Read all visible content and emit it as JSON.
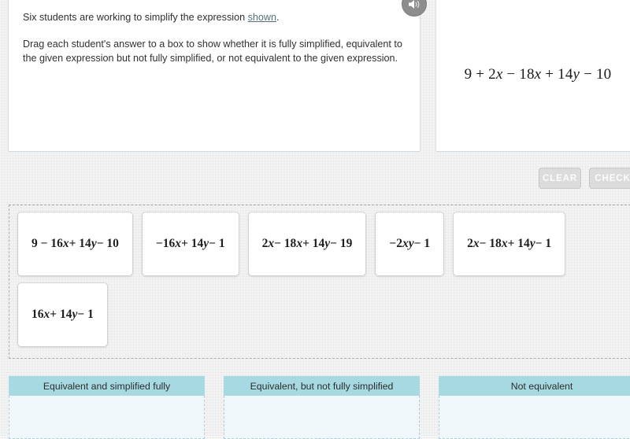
{
  "prompt": {
    "line1_before": "Six students are working to simplify the expression ",
    "line1_link": "shown",
    "line1_after": ".",
    "line2": "Drag each student's answer to a box to show whether it is fully simplified, equivalent to the given expression but not fully simplified, or not equivalent to the given expression."
  },
  "expression": {
    "display": "9 + 2x − 18x + 14y − 10",
    "parts": [
      {
        "t": "9 + 2",
        "italic": false
      },
      {
        "t": "x",
        "italic": true
      },
      {
        "t": " − 18",
        "italic": false
      },
      {
        "t": "x",
        "italic": true
      },
      {
        "t": " + 14",
        "italic": false
      },
      {
        "t": "y",
        "italic": true
      },
      {
        "t": " − 10",
        "italic": false
      }
    ]
  },
  "audio": {
    "icon": "speaker-icon",
    "label": "Read aloud"
  },
  "toolbar": {
    "clear_label": "CLEAR",
    "check_label": "CHECK",
    "disabled": true
  },
  "tiles": [
    {
      "id": "tile-1",
      "display": "9 − 16x + 14y − 10",
      "parts": [
        {
          "t": "9 − 16",
          "italic": false
        },
        {
          "t": "x",
          "italic": true
        },
        {
          "t": " + 14",
          "italic": false
        },
        {
          "t": "y",
          "italic": true
        },
        {
          "t": " − 10",
          "italic": false
        }
      ]
    },
    {
      "id": "tile-2",
      "display": "−16x + 14y − 1",
      "parts": [
        {
          "t": "−16",
          "italic": false
        },
        {
          "t": "x",
          "italic": true
        },
        {
          "t": " + 14",
          "italic": false
        },
        {
          "t": "y",
          "italic": true
        },
        {
          "t": " − 1",
          "italic": false
        }
      ]
    },
    {
      "id": "tile-3",
      "display": "2x − 18x + 14y − 19",
      "parts": [
        {
          "t": "2",
          "italic": false
        },
        {
          "t": "x",
          "italic": true
        },
        {
          "t": " − 18",
          "italic": false
        },
        {
          "t": "x",
          "italic": true
        },
        {
          "t": " + 14",
          "italic": false
        },
        {
          "t": "y",
          "italic": true
        },
        {
          "t": " − 19",
          "italic": false
        }
      ]
    },
    {
      "id": "tile-4",
      "display": "−2xy − 1",
      "parts": [
        {
          "t": "−2",
          "italic": false
        },
        {
          "t": "xy",
          "italic": true
        },
        {
          "t": " − 1",
          "italic": false
        }
      ]
    },
    {
      "id": "tile-5",
      "display": "2x − 18x + 14y − 1",
      "parts": [
        {
          "t": "2",
          "italic": false
        },
        {
          "t": "x",
          "italic": true
        },
        {
          "t": " − 18",
          "italic": false
        },
        {
          "t": "x",
          "italic": true
        },
        {
          "t": " + 14",
          "italic": false
        },
        {
          "t": "y",
          "italic": true
        },
        {
          "t": " − 1",
          "italic": false
        }
      ]
    },
    {
      "id": "tile-6",
      "display": "16x + 14y − 1",
      "parts": [
        {
          "t": "16",
          "italic": false
        },
        {
          "t": "x",
          "italic": true
        },
        {
          "t": " + 14",
          "italic": false
        },
        {
          "t": "y",
          "italic": true
        },
        {
          "t": " − 1",
          "italic": false
        }
      ]
    }
  ],
  "dropzones": [
    {
      "id": "zone-equivalent-simplified",
      "title": "Equivalent and simplified fully",
      "items": []
    },
    {
      "id": "zone-equivalent-not-simplified",
      "title": "Equivalent, but not fully simplified",
      "items": []
    },
    {
      "id": "zone-not-equivalent",
      "title": "Not equivalent",
      "items": []
    }
  ],
  "colors": {
    "page_background": "#e9e9e9",
    "panel_border": "#cfdee4",
    "dropzone_header": "#a6d9e2",
    "dropzone_body": "#eff7fb",
    "button_disabled": "#dcdcdc",
    "link": "#55707d"
  }
}
